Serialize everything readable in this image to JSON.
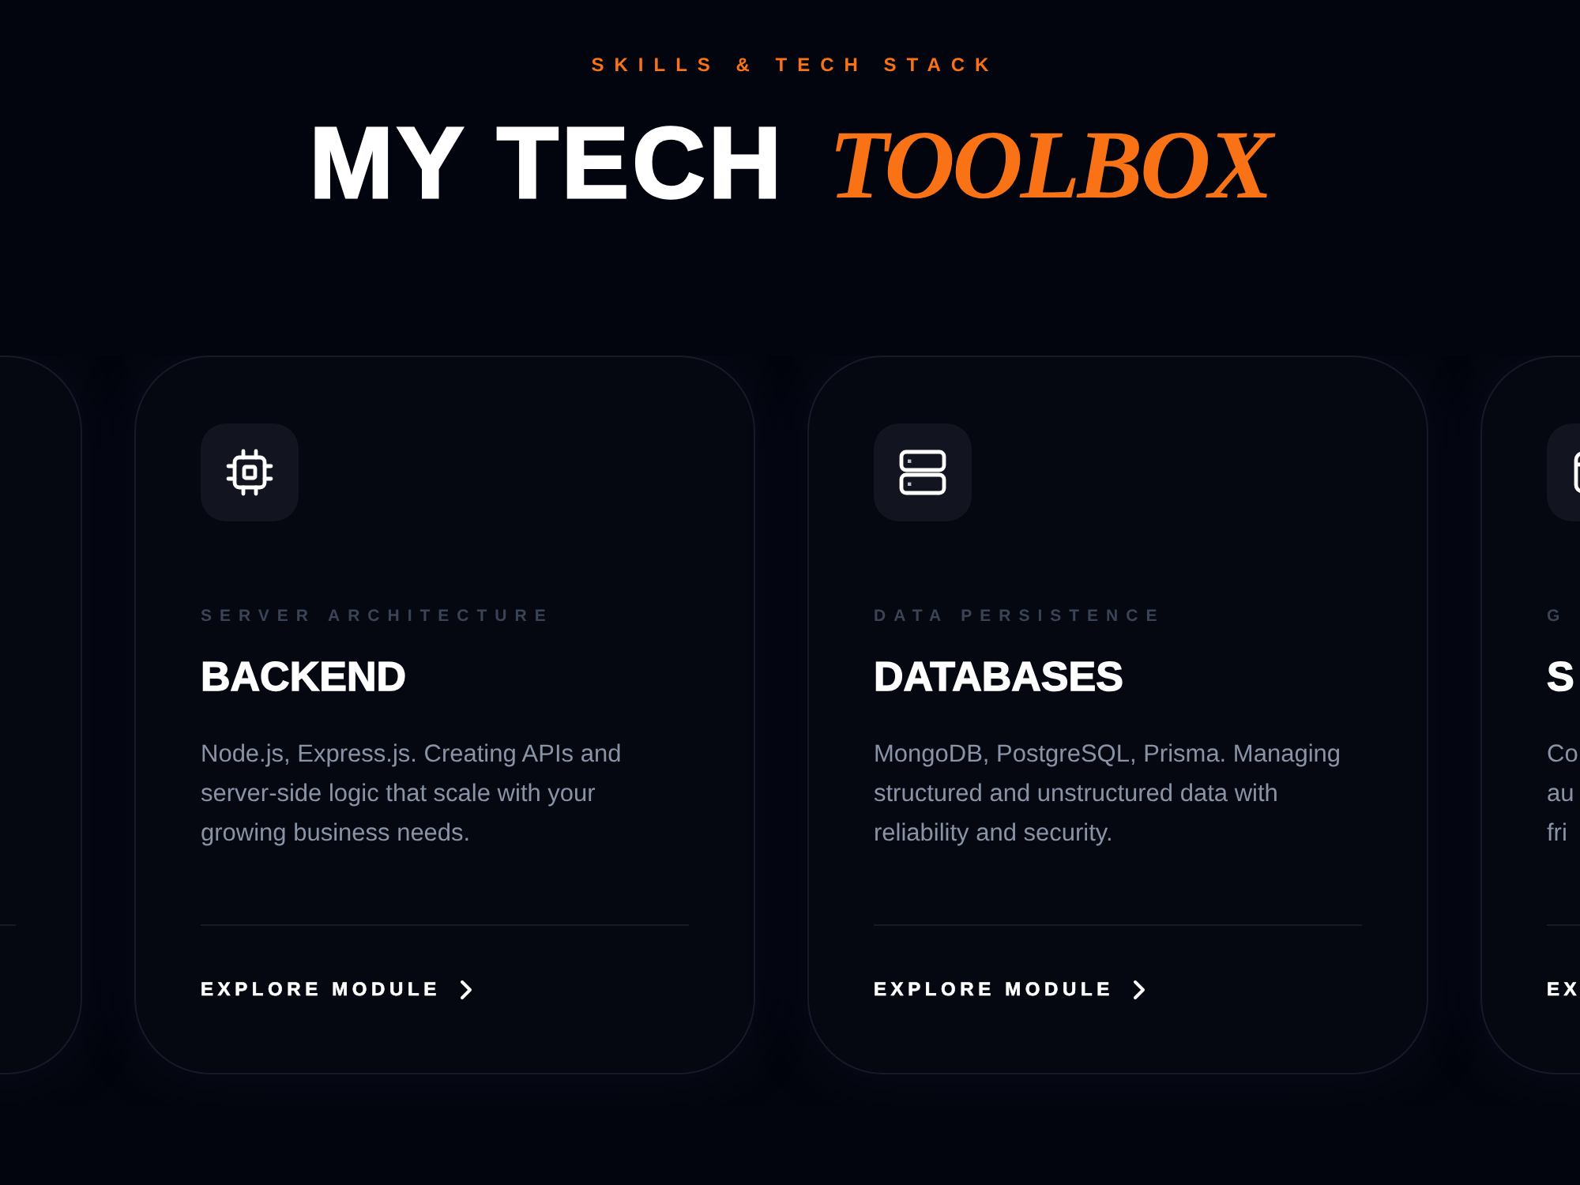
{
  "header": {
    "eyebrow": "SKILLS & TECH STACK",
    "title": "MY TECH",
    "title_accent": "TOOLBOX"
  },
  "cards": [
    {
      "kind": "blank"
    },
    {
      "kind": "module",
      "overline": "SERVER ARCHITECTURE",
      "title": "BACKEND",
      "description": "Node.js, Express.js. Creating APIs and server-side logic that scale with your growing business needs.",
      "link": "EXPLORE MODULE"
    },
    {
      "kind": "module",
      "overline": "DATA PERSISTENCE",
      "title": "DATABASES",
      "description": "MongoDB, PostgreSQL, Prisma. Managing structured and unstructured data with reliability and security.",
      "link": "EXPLORE MODULE"
    },
    {
      "kind": "clipped",
      "overline": "G",
      "title": "S",
      "description": "Co\nau\nfri",
      "link": "EX"
    }
  ]
}
